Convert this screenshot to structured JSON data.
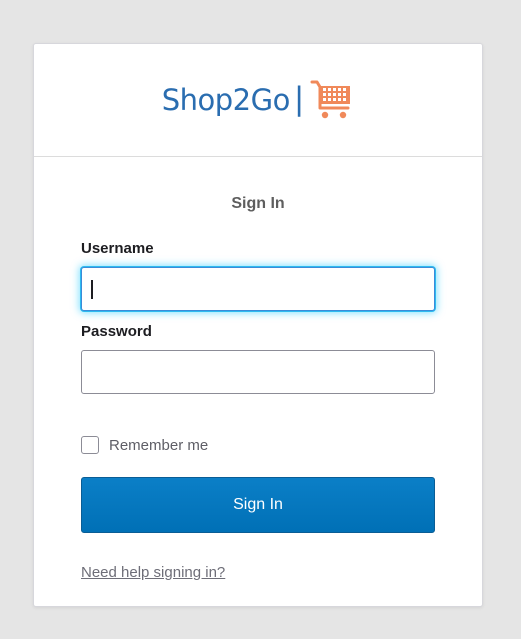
{
  "logo": {
    "text": "Shop2Go",
    "separator": "|",
    "icon": "shopping-cart-icon",
    "text_color": "#2a6db0",
    "icon_color": "#f0895a"
  },
  "form": {
    "title": "Sign In",
    "username_label": "Username",
    "username_value": "",
    "password_label": "Password",
    "password_value": "",
    "remember_label": "Remember me",
    "remember_checked": false,
    "submit_label": "Sign In",
    "help_link": "Need help signing in?"
  },
  "colors": {
    "primary_button": "#0070b6",
    "focus_glow": "#2dbbf0",
    "page_background": "#e5e5e5"
  }
}
